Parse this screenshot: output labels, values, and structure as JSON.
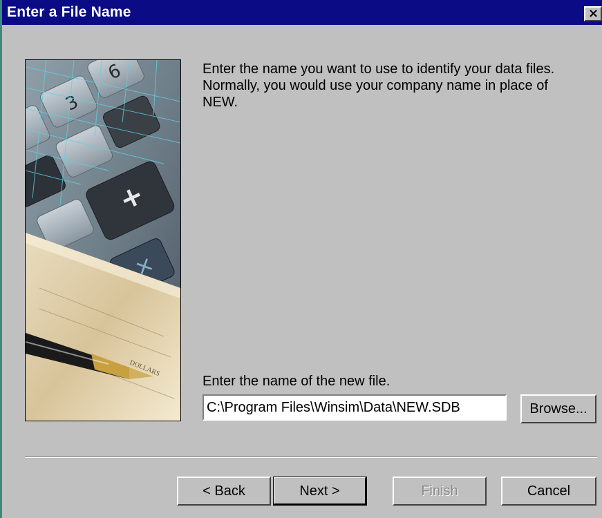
{
  "dialog": {
    "title": "Enter a File Name",
    "close_glyph": "×"
  },
  "content": {
    "description": "Enter the name you want to use to identify your data files.  Normally, you would use your company name in place of NEW.",
    "file_label": "Enter the name of the new file.",
    "file_value": "C:\\Program Files\\Winsim\\Data\\NEW.SDB",
    "browse_label": "Browse..."
  },
  "image": {
    "name": "calculator-and-pen-illustration"
  },
  "buttons": {
    "back": "< Back",
    "next": "Next >",
    "finish": "Finish",
    "cancel": "Cancel"
  }
}
